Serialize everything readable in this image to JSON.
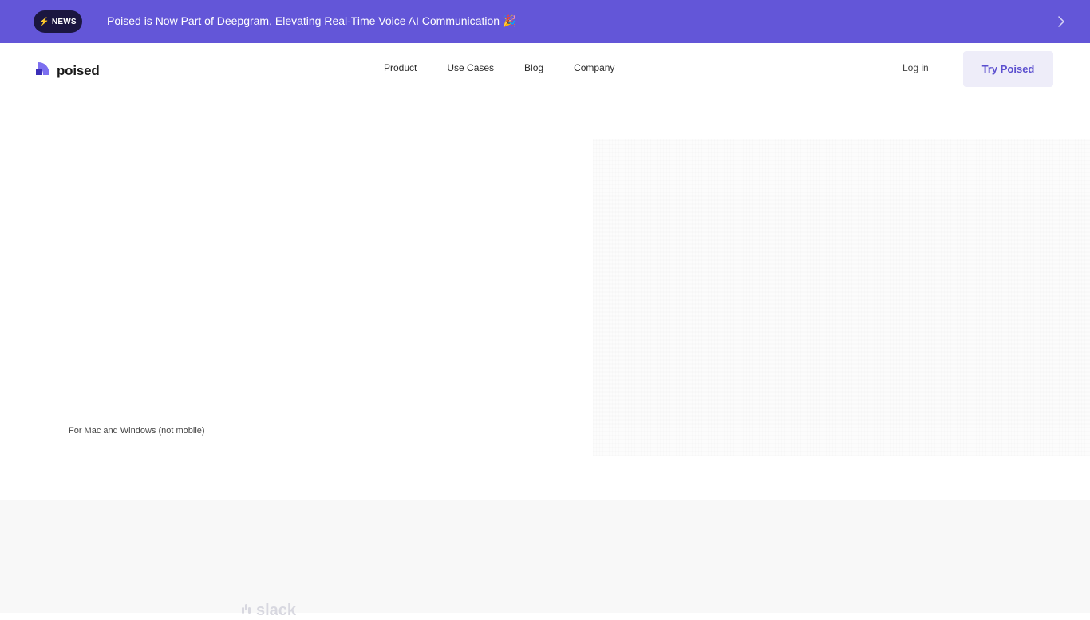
{
  "announcement": {
    "badge": "NEWS",
    "badge_icon": "lightning-icon",
    "text": "Poised is Now Part of Deepgram, Elevating Real-Time Voice AI Communication 🎉",
    "background": "#6356d8"
  },
  "header": {
    "logo_text": "poised",
    "nav": [
      {
        "label": "Product"
      },
      {
        "label": "Use Cases"
      },
      {
        "label": "Blog"
      },
      {
        "label": "Company"
      }
    ],
    "login_label": "Log in",
    "cta_label": "Try Poised",
    "accent": "#5b4fcf"
  },
  "hero": {
    "platform_note": "For Mac and Windows (not mobile)"
  },
  "logos": {
    "items": [
      {
        "name": "slack",
        "icon": "slack-icon"
      }
    ]
  }
}
